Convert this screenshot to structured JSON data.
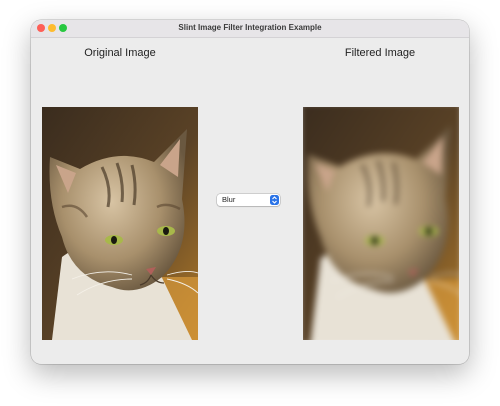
{
  "window": {
    "title": "Slint Image Filter Integration Example"
  },
  "panels": {
    "original_label": "Original Image",
    "filtered_label": "Filtered Image"
  },
  "filter": {
    "selected": "Blur"
  },
  "icons": {
    "close": "close-icon",
    "minimize": "minimize-icon",
    "maximize": "maximize-icon",
    "dropdown": "chevron-updown-icon"
  },
  "colors": {
    "close": "#fe5f57",
    "minimize": "#febc2e",
    "maximize": "#28c840",
    "accent": "#2a73e8",
    "window_bg": "#ececec"
  }
}
